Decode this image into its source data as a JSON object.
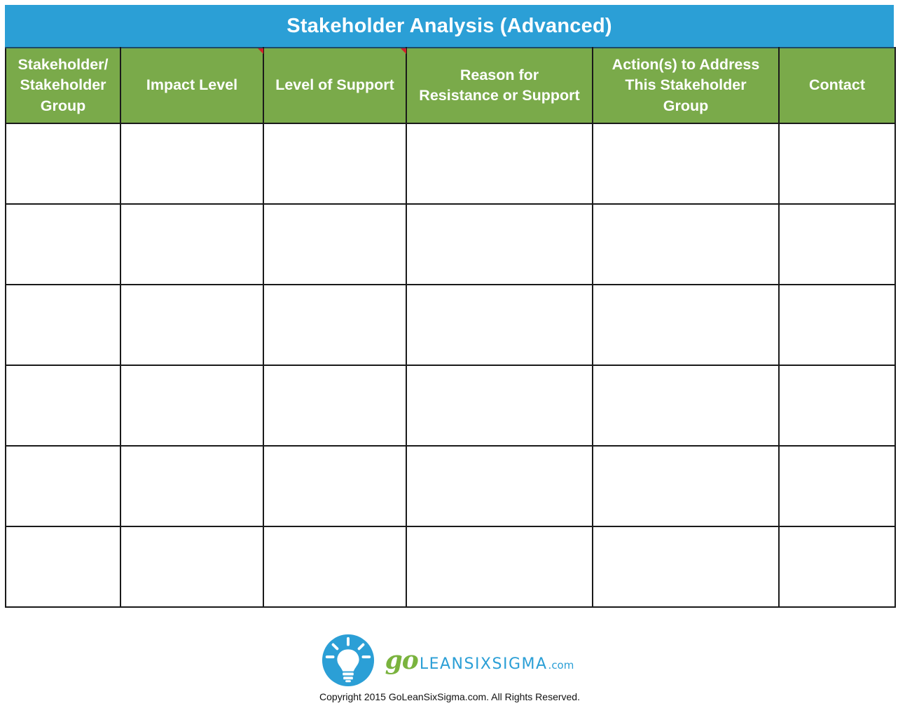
{
  "title": "Stakeholder Analysis (Advanced)",
  "colors": {
    "title_bar": "#2b9fd6",
    "header_row": "#7aaa4a",
    "comment_flag": "#d0202a",
    "brand_green": "#7ab33e",
    "brand_blue": "#2b9fd6"
  },
  "table": {
    "headers": [
      {
        "label": "Stakeholder/ Stakeholder Group",
        "lines": [
          "Stakeholder/",
          "Stakeholder",
          "Group"
        ],
        "has_comment": false
      },
      {
        "label": "Impact Level",
        "lines": [
          "Impact Level"
        ],
        "has_comment": true
      },
      {
        "label": "Level of Support",
        "lines": [
          "Level of Support"
        ],
        "has_comment": true
      },
      {
        "label": "Reason for Resistance or Support",
        "lines": [
          "Reason for",
          "Resistance or Support"
        ],
        "has_comment": false
      },
      {
        "label": "Action(s) to Address This Stakeholder Group",
        "lines": [
          "Action(s) to Address",
          "This Stakeholder",
          "Group"
        ],
        "has_comment": false
      },
      {
        "label": "Contact",
        "lines": [
          "Contact"
        ],
        "has_comment": false
      }
    ],
    "rows": [
      [
        "",
        "",
        "",
        "",
        "",
        ""
      ],
      [
        "",
        "",
        "",
        "",
        "",
        ""
      ],
      [
        "",
        "",
        "",
        "",
        "",
        ""
      ],
      [
        "",
        "",
        "",
        "",
        "",
        ""
      ],
      [
        "",
        "",
        "",
        "",
        "",
        ""
      ],
      [
        "",
        "",
        "",
        "",
        "",
        ""
      ]
    ]
  },
  "footer": {
    "logo_icon": "lightbulb-icon",
    "brand_go": "go",
    "brand_name": "LEANSIXSIGMA",
    "brand_tld": ".com",
    "copyright": "Copyright 2015 GoLeanSixSigma.com. All Rights Reserved."
  }
}
